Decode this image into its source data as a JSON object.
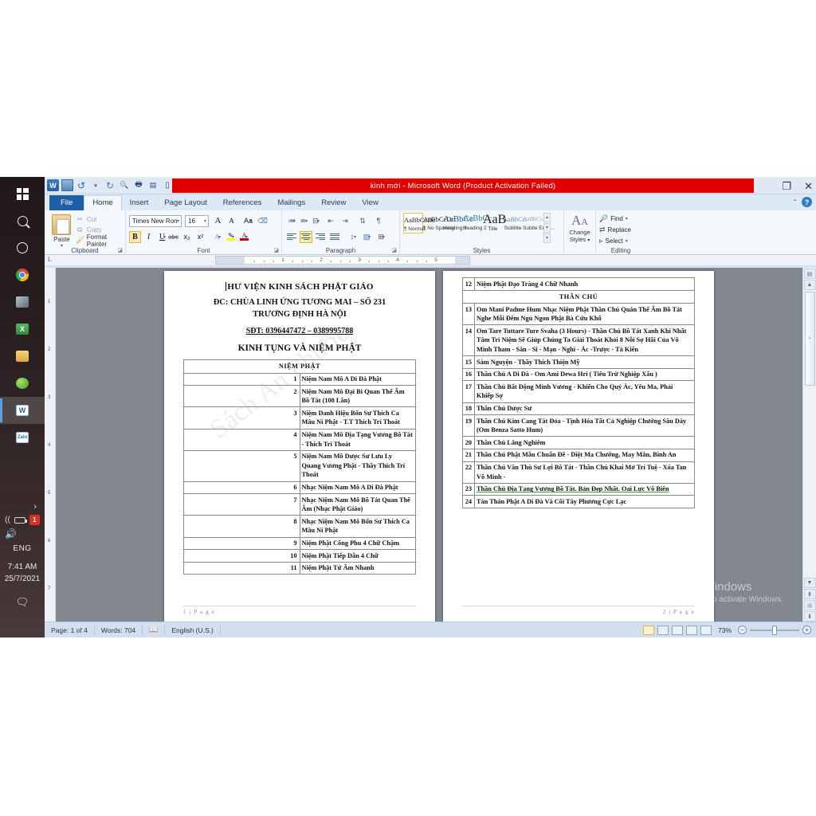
{
  "window": {
    "title": "kinh mới  -  Microsoft Word (Product Activation Failed)",
    "restore_label": "❐",
    "close_label": "✕",
    "help_label": "?",
    "collapse_ribbon_label": "⌃"
  },
  "quick_access": [
    {
      "name": "word-logo",
      "glyph": "W"
    },
    {
      "name": "save-icon",
      "glyph": ""
    },
    {
      "name": "undo-icon",
      "glyph": "↺"
    },
    {
      "name": "undo-dropdown-icon",
      "glyph": "·"
    },
    {
      "name": "redo-icon",
      "glyph": "↻"
    },
    {
      "name": "print-preview-icon",
      "glyph": "🔍"
    },
    {
      "name": "quick-print-icon",
      "glyph": "🖨"
    },
    {
      "name": "open-icon",
      "glyph": "📋"
    },
    {
      "name": "new-icon",
      "glyph": "📄"
    },
    {
      "name": "customize-qat-icon",
      "glyph": "▾"
    }
  ],
  "tabs": [
    {
      "label": "File",
      "selected": false,
      "file": true
    },
    {
      "label": "Home",
      "selected": true
    },
    {
      "label": "Insert",
      "selected": false
    },
    {
      "label": "Page Layout",
      "selected": false
    },
    {
      "label": "References",
      "selected": false
    },
    {
      "label": "Mailings",
      "selected": false
    },
    {
      "label": "Review",
      "selected": false
    },
    {
      "label": "View",
      "selected": false
    }
  ],
  "ribbon": {
    "clipboard": {
      "group_label": "Clipboard",
      "paste_label": "Paste",
      "cut_label": "Cut",
      "copy_label": "Copy",
      "format_painter_label": "Format Painter"
    },
    "font": {
      "group_label": "Font",
      "font_name": "Times New Ron",
      "font_size": "16",
      "grow_label": "A",
      "shrink_label": "A",
      "change_case_label": "Aa",
      "clear_formatting_label": "",
      "bold_label": "B",
      "italic_label": "I",
      "underline_label": "U",
      "strikethrough_label": "abc",
      "subscript_label": "x₂",
      "superscript_label": "x²",
      "text_effects_label": "A",
      "highlight_label": "✎",
      "font_color_label": "A",
      "highlight_color": "#ffff00",
      "font_color": "#c00000"
    },
    "paragraph": {
      "group_label": "Paragraph",
      "bullets_label": "☰",
      "numbering_label": "☷",
      "multilevel_label": "☶",
      "decrease_indent_label": "⇤",
      "increase_indent_label": "⇥",
      "sort_label": "↓",
      "show_marks_label": "¶",
      "align_left_label": "",
      "align_center_label": "",
      "align_right_label": "",
      "justify_label": "",
      "line_spacing_label": "↕",
      "shading_label": "▨",
      "borders_label": "⊞"
    },
    "styles": {
      "group_label": "Styles",
      "items": [
        {
          "preview": "AaBbCcDc",
          "name": "¶ Normal",
          "selected": true,
          "size": "10px",
          "color": "#222222"
        },
        {
          "preview": "AaBbCcDc",
          "name": "¶ No Spacing",
          "selected": false,
          "size": "10px",
          "color": "#222222"
        },
        {
          "preview": "AaBbCс",
          "name": "Heading 1",
          "selected": false,
          "size": "12px",
          "color": "#2f5496"
        },
        {
          "preview": "AaBbCc",
          "name": "Heading 2",
          "selected": false,
          "size": "11px",
          "color": "#2f7ec4"
        },
        {
          "preview": "AaB",
          "name": "Title",
          "selected": false,
          "size": "16px",
          "color": "#1a1a1a"
        },
        {
          "preview": "AaBbCc.",
          "name": "Subtitle",
          "selected": false,
          "size": "10px",
          "color": "#6a8fc0"
        },
        {
          "preview": "AaBbCcDa",
          "name": "Subtle Emp…",
          "selected": false,
          "size": "9px",
          "color": "#9aa8ba"
        }
      ],
      "change_styles_label_1": "Change",
      "change_styles_label_2": "Styles"
    },
    "editing": {
      "group_label": "Editing",
      "find_label": "Find",
      "replace_label": "Replace",
      "select_label": "Select"
    }
  },
  "ruler": {
    "unit_marks": [
      "1",
      "2",
      "3",
      "4",
      "5"
    ],
    "tab_stop_label": "L"
  },
  "document": {
    "page1": {
      "header_line1": "HƯ VIỆN KINH SÁCH PHẬT GIÁO",
      "header_line2": "ĐC: CHÙA LINH ỨNG TƯƠNG MAI – SỐ 231",
      "header_line3": "TRƯƠNG ĐỊNH HÀ NỘI",
      "phone": "SĐT: 0396447472 – 0389995788",
      "subtitle": "KINH TỤNG VÀ NIỆM PHẬT",
      "table_title": "NIỆM PHẬT",
      "rows": [
        {
          "no": "1",
          "text": "Niệm Nam Mô A Di Đà Phật"
        },
        {
          "no": "2",
          "text": "Niệm Nam Mô Đại Bi Quan Thế Âm Bồ Tát (108 Lần)"
        },
        {
          "no": "3",
          "text": "Niệm Danh Hiệu Bổn Sư Thích Ca Mâu Ni Phật - T.T Thích Trí Thoát"
        },
        {
          "no": "4",
          "text": "Niệm Nam Mô Địa Tạng Vương Bồ Tát - Thích Trí Thoát"
        },
        {
          "no": "5",
          "text": "Niệm Nam Mô Dược Sư Lưu Ly Quang Vương Phật - Thầy Thích Trí Thoát"
        },
        {
          "no": "6",
          "text": "Nhạc Niệm Nam Mô A Di Đà Phật"
        },
        {
          "no": "7",
          "text": "Nhạc Niệm Nam Mô Bồ Tát Quan Thế Âm (Nhạc Phật Giáo)"
        },
        {
          "no": "8",
          "text": "Nhạc Niệm Nam Mô Bổn Sư Thích Ca Mâu Ni Phật"
        },
        {
          "no": "9",
          "text": "Niệm Phật Công Phu 4 Chữ Chậm"
        },
        {
          "no": "10",
          "text": "Niệm Phật Tiếp Dẫn 4 Chữ"
        },
        {
          "no": "11",
          "text": "Niệm Phật Tứ Âm Nhanh"
        }
      ],
      "footer": "1 | P a g e",
      "watermark": "Sách An Phước"
    },
    "page2": {
      "table_title": "THẦN CHÚ",
      "rows": [
        {
          "no": "12",
          "text": "Niệm Phật Đạo Tràng 4 Chữ Nhanh"
        },
        {
          "no": "13",
          "text": "Om Mani Padme Hum Nhạc Niệm Phật Thần Chú Quán Thế Âm Bồ Tát Nghe Mỗi Đêm Ngủ Ngon Phật Bà Cứu Khổ"
        },
        {
          "no": "14",
          "text": "Om Tare Tuttare Ture Svaha (3 Hours) - Thần Chú Bồ Tát Xanh Khi Nhất Tâm Trì Niệm Sẽ Giúp Chúng Ta Giải Thoát Khỏi 8 Nỗi Sợ Hãi Của Vô Minh Tham - Sân - Si - Mạn - Nghi - Ác -Trược - Tà Kiến"
        },
        {
          "no": "15",
          "text": "Sám Nguyện - Thầy Thích Thiện Mỹ"
        },
        {
          "no": "16",
          "text": "Thần Chú A Di Đà - Om Ami Dewa Hri ( Tiêu Trừ Nghiệp Xấu )"
        },
        {
          "no": "17",
          "text": "Thần Chú Bất Động Minh Vương - Khiến Cho Quỷ Ác, Yêu Ma, Phải Khiếp Sợ"
        },
        {
          "no": "18",
          "text": "Thần Chú Dược Sư"
        },
        {
          "no": "19",
          "text": "Thần Chú Kim Cang Tát Đỏa - Tịnh Hóa Tất Cả Nghiệp Chướng Sâu Dày (Om Benza Satto Hum)"
        },
        {
          "no": "20",
          "text": "Thần Chú Lăng Nghiêm"
        },
        {
          "no": "21",
          "text": "Thần Chú Phật Mẫu Chuẩn Đề - Diệt Ma Chướng, May Mắn, Bình An"
        },
        {
          "no": "22",
          "text": "Thần Chú Văn Thù Sư Lợi Bồ Tát - Thần Chú Khai Mở Trí Tuệ - Xóa Tan Vô Minh -"
        },
        {
          "no": "23",
          "text": "Thần Chú Địa Tạng Vương Bồ Tát. Bản Đẹp Nhất. Oai Lực Vô Biên"
        },
        {
          "no": "24",
          "text": "Tán Thán Phật A Di Đà Và Cõi Tây Phương Cực Lạc"
        }
      ],
      "footer": "2 | P a g e"
    }
  },
  "activation_watermark": {
    "line1": "Activate Windows",
    "line2": "Go to Settings to activate Windows."
  },
  "status_bar": {
    "page": "Page: 1 of 4",
    "words": "Words: 704",
    "language": "English (U.S.)",
    "zoom": "73%",
    "zoom_out_label": "−",
    "zoom_in_label": "+",
    "views": [
      "print-layout",
      "full-screen-reading",
      "web-layout",
      "outline",
      "draft"
    ]
  },
  "taskbar": {
    "items": [
      {
        "name": "start-button",
        "glyph": ""
      },
      {
        "name": "search-icon",
        "glyph": ""
      },
      {
        "name": "cortana-icon",
        "glyph": ""
      },
      {
        "name": "chrome-icon",
        "glyph": ""
      },
      {
        "name": "unikey-icon",
        "glyph": ""
      },
      {
        "name": "excel-icon",
        "glyph": "X"
      },
      {
        "name": "file-explorer-icon",
        "glyph": ""
      },
      {
        "name": "app-green-icon",
        "glyph": ""
      },
      {
        "name": "word-taskbar-icon",
        "glyph": "W"
      },
      {
        "name": "zalo-icon",
        "glyph": "Zalo"
      }
    ],
    "tray": {
      "language": "ENG",
      "time": "7:41 AM",
      "date": "25/7/2021",
      "battery_badge": "1"
    }
  }
}
